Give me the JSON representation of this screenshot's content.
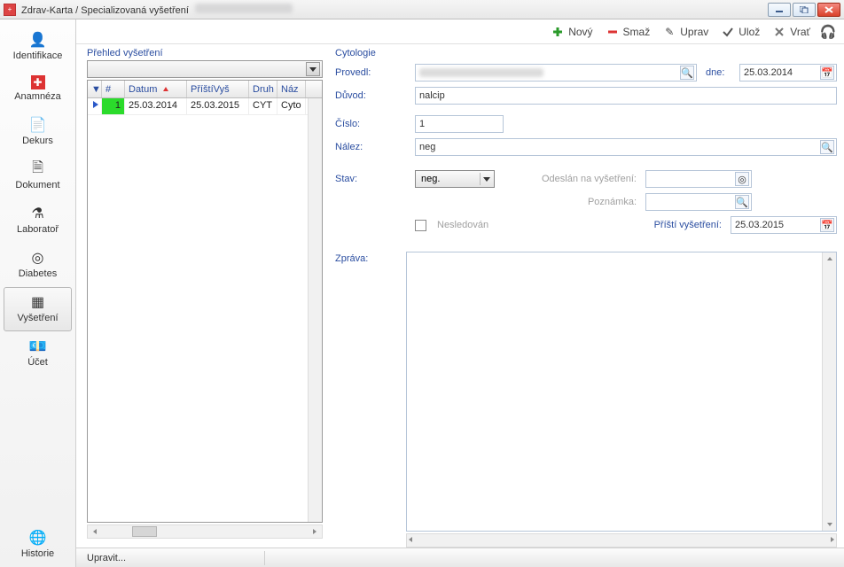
{
  "window": {
    "title_prefix": "Zdrav-Karta / Specializovaná vyšetření"
  },
  "sidebar": {
    "items": [
      {
        "label": "Identifikace",
        "icon": "person-icon"
      },
      {
        "label": "Anamnéza",
        "icon": "plus-icon"
      },
      {
        "label": "Dekurs",
        "icon": "page-icon"
      },
      {
        "label": "Dokument",
        "icon": "doc-icon"
      },
      {
        "label": "Laboratoř",
        "icon": "flask-icon"
      },
      {
        "label": "Diabetes",
        "icon": "heart-icon"
      },
      {
        "label": "Vyšetření",
        "icon": "grid-icon"
      },
      {
        "label": "Účet",
        "icon": "money-icon"
      },
      {
        "label": "Historie",
        "icon": "globe-icon"
      }
    ],
    "selected_index": 6
  },
  "toolbar": {
    "new": "Nový",
    "delete": "Smaž",
    "edit": "Uprav",
    "save": "Ulož",
    "undo": "Vrať"
  },
  "list": {
    "title": "Přehled vyšetření",
    "columns": {
      "marker": "▼",
      "num": "#",
      "date": "Datum",
      "next": "PříštíVyš",
      "kind": "Druh",
      "name": "Náz"
    },
    "rows": [
      {
        "num": "1",
        "date": "25.03.2014",
        "next": "25.03.2015",
        "kind": "CYT",
        "name": "Cyto"
      }
    ]
  },
  "detail": {
    "section_title": "Cytologie",
    "labels": {
      "provedl": "Provedl:",
      "dne": "dne:",
      "duvod": "Důvod:",
      "cislo": "Číslo:",
      "nalez": "Nález:",
      "stav": "Stav:",
      "odeslan": "Odeslán na vyšetření:",
      "poznamka": "Poznámka:",
      "nesledovan": "Nesledován",
      "pristi": "Příští vyšetření:",
      "zprava": "Zpráva:"
    },
    "values": {
      "dne": "25.03.2014",
      "duvod": "nalcip",
      "cislo": "1",
      "nalez": "neg",
      "stav": "neg.",
      "pristi": "25.03.2015"
    }
  },
  "statusbar": {
    "edit": "Upravit..."
  }
}
